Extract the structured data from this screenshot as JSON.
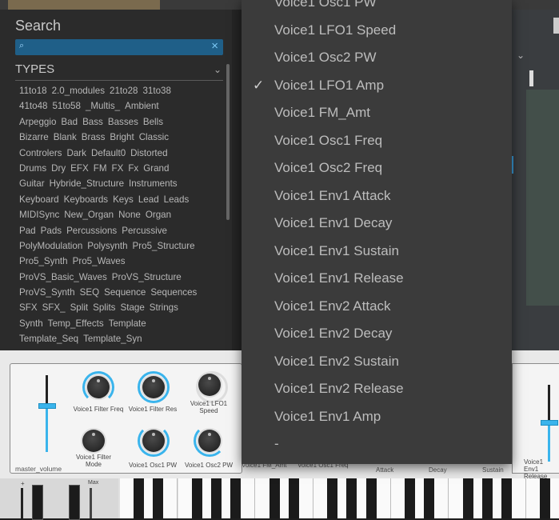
{
  "browser": {
    "search_title": "Search",
    "search_placeholder": "",
    "types_label": "TYPES",
    "type_rows": [
      [
        "11to18",
        "2.0_modules",
        "21to28",
        "31to38"
      ],
      [
        "41to48",
        "51to58",
        "_Multis_",
        "Ambient"
      ],
      [
        "Arpeggio",
        "Bad",
        "Bass",
        "Basses",
        "Bells"
      ],
      [
        "Bizarre",
        "Blank",
        "Brass",
        "Bright",
        "Classic"
      ],
      [
        "Controlers",
        "Dark",
        "Default0",
        "Distorted"
      ],
      [
        "Drums",
        "Dry",
        "EFX",
        "FM",
        "FX",
        "Fx",
        "Grand"
      ],
      [
        "Guitar",
        "Hybride_Structure",
        "Instruments"
      ],
      [
        "Keyboard",
        "Keyboards",
        "Keys",
        "Lead",
        "Leads"
      ],
      [
        "MIDISync",
        "New_Organ",
        "None",
        "Organ"
      ],
      [
        "Pad",
        "Pads",
        "Percussions",
        "Percussive"
      ],
      [
        "PolyModulation",
        "Polysynth",
        "Pro5_Structure"
      ],
      [
        "Pro5_Synth",
        "Pro5_Waves"
      ],
      [
        "ProVS_Basic_Waves",
        "ProVS_Structure"
      ],
      [
        "ProVS_Synth",
        "SEQ",
        "Sequence",
        "Sequences"
      ],
      [
        "SFX",
        "SFX_",
        "Split",
        "Splits",
        "Stage",
        "Strings"
      ],
      [
        "Synth",
        "Temp_Effects",
        "Template"
      ],
      [
        "Template_Seq",
        "Template_Syn"
      ]
    ]
  },
  "menu": {
    "selected_index": 3,
    "check_glyph": "✓",
    "items": [
      "Voice1 Osc1 PW",
      "Voice1 LFO1 Speed",
      "Voice1 Osc2 PW",
      "Voice1 LFO1 Amp",
      "Voice1 FM_Amt",
      "Voice1 Osc1 Freq",
      "Voice1 Osc2 Freq",
      "Voice1 Env1 Attack",
      "Voice1 Env1 Decay",
      "Voice1 Env1 Sustain",
      "Voice1 Env1 Release",
      "Voice1 Env2 Attack",
      "Voice1 Env2 Decay",
      "Voice1 Env2 Sustain",
      "Voice1 Env2 Release",
      "Voice1 Env1 Amp",
      "-"
    ]
  },
  "controls": {
    "master_volume_label": "master_volume",
    "knobs_top": [
      "Voice1 Filter Freq",
      "Voice1 Filter Res",
      "Voice1 LFO1 Speed"
    ],
    "knobs_bottom": [
      "Voice1 Filter Mode",
      "Voice1 Osc1 PW",
      "Voice1 Osc2 PW"
    ],
    "hidden_labels": [
      "Voice1 FM_Amt",
      "Voice1 Osc1 Freq",
      "Attack",
      "Decay",
      "Sustain"
    ],
    "right_label": "Voice1 Env1 Release",
    "master_volume_level": 0.6,
    "accent_color": "#3ab4ec"
  },
  "keyboard": {
    "max_label": "Max",
    "plus_label": "+"
  }
}
